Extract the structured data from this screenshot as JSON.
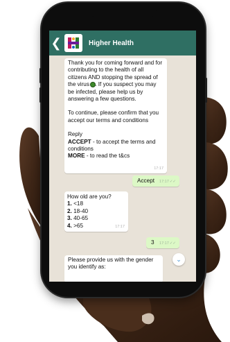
{
  "header": {
    "back_glyph": "❮",
    "contact_name": "Higher Health"
  },
  "colors": {
    "header": "#2f6f63",
    "incoming_bubble": "#ffffff",
    "outgoing_bubble": "#dcf8c6",
    "chat_background": "#e8e2d8"
  },
  "messages": {
    "welcome": {
      "text_before_icon": "Thank you for coming forward and for contributing to the health of all citizens AND stopping the spread of the virus ",
      "text_after_icon": ". If you suspect you may be infected, please help us by answering a few questions.",
      "confirm": "To continue, please confirm that you accept our terms and conditions",
      "reply": "Reply",
      "accept_keyword": "ACCEPT",
      "accept_desc": " - to accept the terms and conditions",
      "more_keyword": "MORE",
      "more_desc": " - to read the t&cs",
      "time": "17:17"
    },
    "accept_reply": {
      "text": "Accept",
      "time": "17:17"
    },
    "age_question": {
      "question": "How old are you?",
      "options": [
        {
          "num": "1.",
          "label": " <18"
        },
        {
          "num": "2.",
          "label": " 18-40"
        },
        {
          "num": "3.",
          "label": " 40-65"
        },
        {
          "num": "4.",
          "label": " >65"
        }
      ],
      "time": "17:17"
    },
    "age_reply": {
      "text": "3",
      "time": "17:17"
    },
    "gender_question": {
      "text": "Please provide us with the gender you identify as:"
    }
  }
}
